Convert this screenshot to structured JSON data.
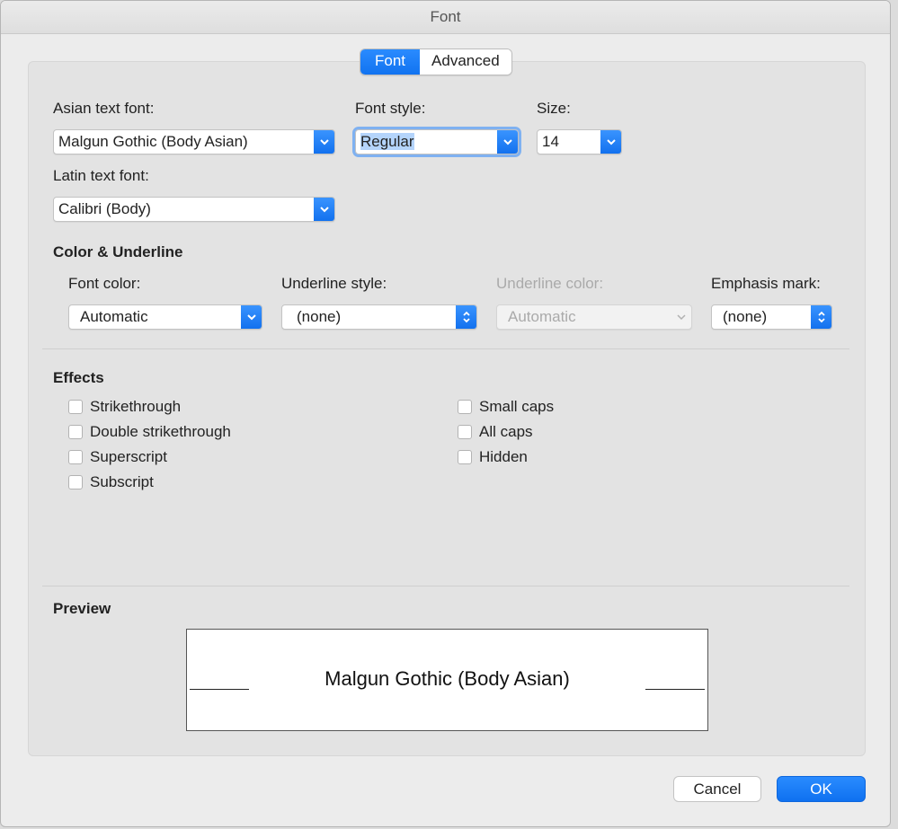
{
  "window": {
    "title": "Font"
  },
  "tabs": [
    {
      "label": "Font",
      "active": true
    },
    {
      "label": "Advanced",
      "active": false
    }
  ],
  "fields": {
    "asian_font": {
      "label": "Asian text font:",
      "value": "Malgun Gothic (Body Asian)"
    },
    "font_style": {
      "label": "Font style:",
      "value": "Regular"
    },
    "size": {
      "label": "Size:",
      "value": "14"
    },
    "latin_font": {
      "label": "Latin text font:",
      "value": "Calibri (Body)"
    }
  },
  "color_underline": {
    "heading": "Color & Underline",
    "font_color": {
      "label": "Font color:",
      "value": "Automatic"
    },
    "underline_style": {
      "label": "Underline style:",
      "value": "(none)"
    },
    "underline_color": {
      "label": "Underline color:",
      "value": "Automatic",
      "disabled": true
    },
    "emphasis_mark": {
      "label": "Emphasis mark:",
      "value": "(none)"
    }
  },
  "effects": {
    "heading": "Effects",
    "left": [
      "Strikethrough",
      "Double strikethrough",
      "Superscript",
      "Subscript"
    ],
    "right": [
      "Small caps",
      "All caps",
      "Hidden"
    ]
  },
  "preview": {
    "heading": "Preview",
    "text": "Malgun Gothic (Body Asian)"
  },
  "buttons": {
    "cancel": "Cancel",
    "ok": "OK"
  },
  "colors": {
    "accent": "#1173f0",
    "panel": "#e3e3e3",
    "window": "#ececec"
  }
}
